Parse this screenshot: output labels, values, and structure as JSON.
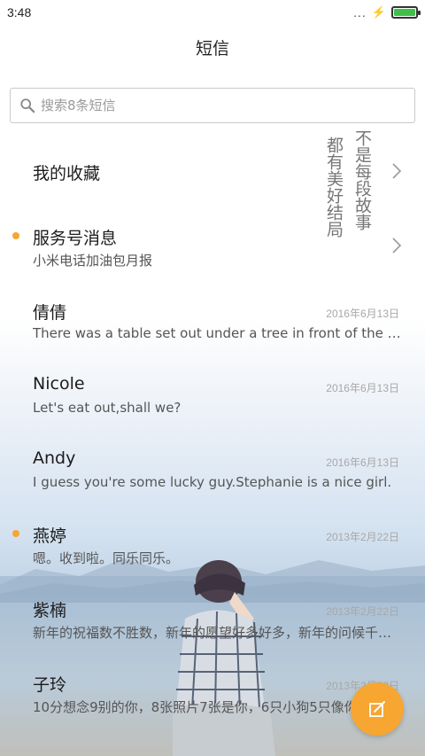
{
  "status_bar": {
    "time": "3:48",
    "signal_dots": "...",
    "battery_color": "#3fbf4a"
  },
  "header": {
    "title": "短信"
  },
  "search": {
    "placeholder": "搜索8条短信"
  },
  "wallpaper_text": {
    "col1": "不是每段故事",
    "col2": "都有美好结局"
  },
  "conversations": [
    {
      "name": "我的收藏",
      "preview": "",
      "date": "",
      "unread": false,
      "has_chevron": true
    },
    {
      "name": "服务号消息",
      "preview": "小米电话加油包月报",
      "date": "",
      "unread": true,
      "has_chevron": true
    },
    {
      "name": "倩倩",
      "preview": "There was a table set out under a tree in front of the house",
      "date": "2016年6月13日",
      "unread": false,
      "has_chevron": false
    },
    {
      "name": "Nicole",
      "preview": "Let's eat out,shall we?",
      "date": "2016年6月13日",
      "unread": false,
      "has_chevron": false
    },
    {
      "name": "Andy",
      "preview": "I guess you're some lucky guy.Stephanie is a nice girl.",
      "date": "2016年6月13日",
      "unread": false,
      "has_chevron": false
    },
    {
      "name": "燕婷",
      "preview": "嗯。收到啦。同乐同乐。",
      "date": "2013年2月22日",
      "unread": true,
      "has_chevron": false
    },
    {
      "name": "紫楠",
      "preview": "新年的祝福数不胜数，新年的愿望好多好多，新年的问候千言万语",
      "date": "2013年2月22日",
      "unread": false,
      "has_chevron": false
    },
    {
      "name": "子玲",
      "preview": "10分想念9别的你，8张照片7张是你，6只小狗5只像你",
      "date": "2013年2月22日",
      "unread": false,
      "has_chevron": false
    }
  ],
  "colors": {
    "accent": "#f6a631",
    "unread_dot": "#f6a631"
  },
  "fab": {
    "icon": "compose-icon"
  }
}
